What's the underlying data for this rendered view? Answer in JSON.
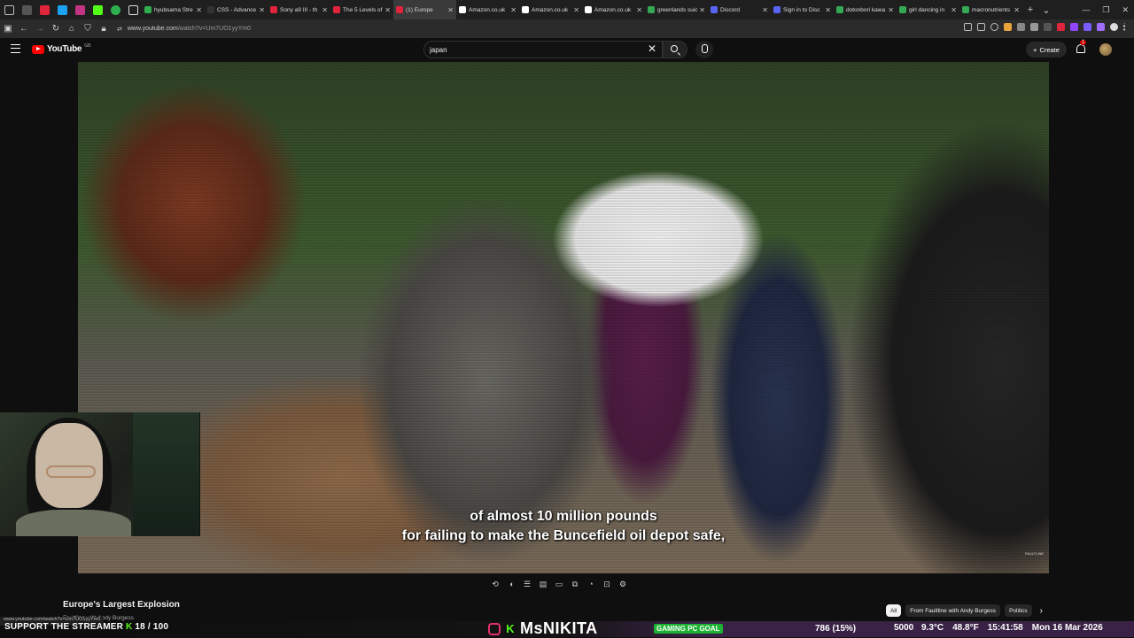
{
  "browser": {
    "tabs": [
      {
        "title": "hyubsama Stre",
        "color": "#2fb04f",
        "active": false
      },
      {
        "title": "CSS - Advance",
        "color": "#333333",
        "active": false
      },
      {
        "title": "Sony a9 III - th",
        "color": "#e0243c",
        "active": false
      },
      {
        "title": "The 5 Levels of",
        "color": "#e0243c",
        "active": false
      },
      {
        "title": "(1) Europe",
        "color": "#e0243c",
        "active": true
      },
      {
        "title": "Amazon.co.uk",
        "color": "#ffffff",
        "active": false
      },
      {
        "title": "Amazon.co.uk",
        "color": "#ffffff",
        "active": false
      },
      {
        "title": "Amazon.co.uk",
        "color": "#ffffff",
        "active": false
      },
      {
        "title": "greenlands suic",
        "color": "#34a853",
        "active": false
      },
      {
        "title": "Discord",
        "color": "#5865f2",
        "active": false
      },
      {
        "title": "Sign in to Disc",
        "color": "#5865f2",
        "active": false
      },
      {
        "title": "dotonbori kawa",
        "color": "#34a853",
        "active": false
      },
      {
        "title": "girl dancing in",
        "color": "#34a853",
        "active": false
      },
      {
        "title": "macronutrients",
        "color": "#34a853",
        "active": false
      }
    ],
    "url_host": "www.youtube.com",
    "url_path": "/watch?v=Um7UO1yyYm0"
  },
  "youtube": {
    "logo_text": "YouTube",
    "logo_country": "GB",
    "search_value": "japan",
    "create_label": "Create",
    "notification_count": "1"
  },
  "video": {
    "subtitle_line1": "of almost 10 million pounds",
    "subtitle_line2": "for failing to make the Buncefield oil depot safe,",
    "watermark": "FAULTLINE"
  },
  "below_video": {
    "title": "Europe's Largest Explosion",
    "channel": "Faultline with Andy Burgess",
    "chips": [
      "All",
      "From Faultline with Andy Burgess",
      "Politics"
    ]
  },
  "status_url": "www.youtube.com/watch?v=Um7UO1yyYm0",
  "stream_overlay": {
    "support_text": "SUPPORT THE STREAMER",
    "support_amount": "18 / 100",
    "streamer_name": "MsNIKITA",
    "goal_label": "GAMING PC GOAL",
    "goal_progress": "786 (15%)",
    "goal_target": "5000",
    "temperature": "9.3°C",
    "cpu_temp": "48.8°F",
    "time": "15:41:58",
    "date": "Mon 16 Mar 2026"
  }
}
